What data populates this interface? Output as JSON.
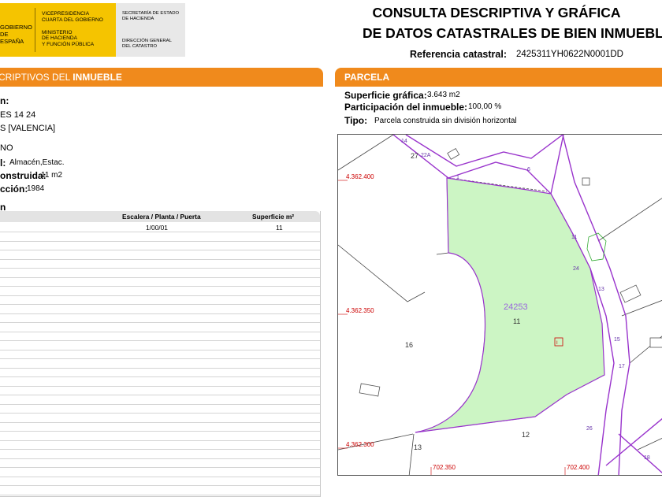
{
  "header": {
    "logo_left": [
      "GOBIERNO",
      "DE ESPAÑA"
    ],
    "logo_mid": [
      "VICEPRESIDENCIA",
      "CUARTA DEL GOBIERNO",
      "",
      "MINISTERIO",
      "DE HACIENDA",
      "Y FUNCIÓN PÚBLICA"
    ],
    "logo_right_top": [
      "SECRETARÍA DE ESTADO",
      "DE HACIENDA"
    ],
    "logo_right_bottom": [
      "DIRECCIÓN GENERAL",
      "DEL CATASTRO"
    ],
    "title_line1": "CONSULTA DESCRIPTIVA Y GRÁFICA",
    "title_line2": "DE DATOS CATASTRALES DE BIEN INMUEBLE",
    "ref_label": "Referencia catastral:",
    "ref_value": "2425311YH0622N0001DD"
  },
  "left_section": {
    "bar_title_prefix": "CRIPTIVOS DEL ",
    "bar_title_bold": "INMUEBLE",
    "loc_label": "n:",
    "loc_line1": "ES 14 24",
    "loc_line2": "S [VALENCIA]",
    "clase": "NO",
    "uso_label": "l:",
    "uso_value": "Almacén,Estac.",
    "sup_label": "onstruida:",
    "sup_value": "11 m2",
    "anio_label": "cción:",
    "anio_value": "1984",
    "const_label": "n",
    "table": {
      "col_planta": "Escalera / Planta / Puerta",
      "col_sup": "Superficie m²",
      "rows": [
        {
          "planta": "1/00/01",
          "sup": "11"
        }
      ]
    }
  },
  "right_section": {
    "bar_title": "PARCELA",
    "sup_label": "Superficie gráfica:",
    "sup_value": "3.643 m2",
    "part_label": "Participación del inmueble:",
    "part_value": "100,00 %",
    "tipo_label": "Tipo:",
    "tipo_value": "Parcela construida sin división horizontal"
  },
  "map": {
    "parcel_fill": "#ccf5c4",
    "parcel_stroke": "#9933cc",
    "coords_y": [
      "4.362.400",
      "4.362.350",
      "4.362.300"
    ],
    "coords_x": [
      "702.350",
      "702.400"
    ],
    "parcel_id": "24253",
    "parcel_num": "11",
    "neighbors": [
      "27",
      "16",
      "12",
      "13"
    ],
    "street_numbers": [
      "14",
      "22A",
      "1",
      "6",
      "11",
      "24",
      "13",
      "15",
      "17",
      "26",
      "18"
    ]
  }
}
